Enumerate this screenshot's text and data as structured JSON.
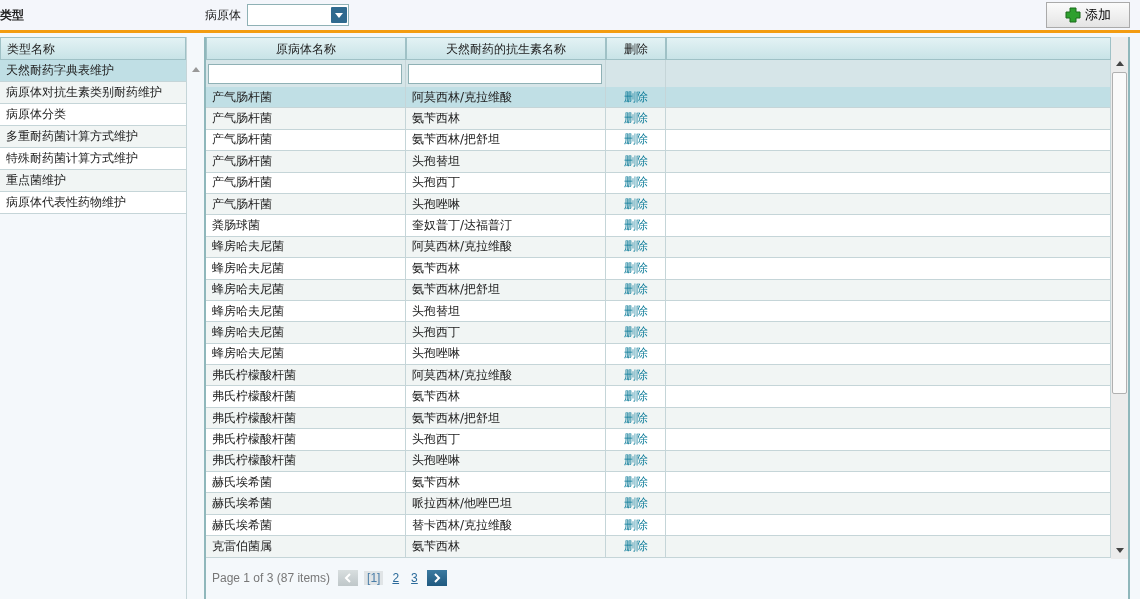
{
  "toolbar": {
    "type_label": "类型",
    "pathogen_label": "病原体",
    "add_button": "添加"
  },
  "sidebar": {
    "header": "类型名称",
    "items": [
      {
        "label": "天然耐药字典表维护",
        "selected": true
      },
      {
        "label": "病原体对抗生素类别耐药维护",
        "selected": false
      },
      {
        "label": "病原体分类",
        "selected": false
      },
      {
        "label": "多重耐药菌计算方式维护",
        "selected": false
      },
      {
        "label": "特殊耐药菌计算方式维护",
        "selected": false
      },
      {
        "label": "重点菌维护",
        "selected": false
      },
      {
        "label": "病原体代表性药物维护",
        "selected": false
      }
    ]
  },
  "table": {
    "columns": [
      "原病体名称",
      "天然耐药的抗生素名称",
      "删除"
    ],
    "rows": [
      {
        "pathogen": "产气肠杆菌",
        "antibiotic": "阿莫西林/克拉维酸",
        "action": "删除",
        "selected": true
      },
      {
        "pathogen": "产气肠杆菌",
        "antibiotic": "氨苄西林",
        "action": "删除",
        "selected": false
      },
      {
        "pathogen": "产气肠杆菌",
        "antibiotic": "氨苄西林/把舒坦",
        "action": "删除",
        "selected": false
      },
      {
        "pathogen": "产气肠杆菌",
        "antibiotic": "头孢替坦",
        "action": "删除",
        "selected": false
      },
      {
        "pathogen": "产气肠杆菌",
        "antibiotic": "头孢西丁",
        "action": "删除",
        "selected": false
      },
      {
        "pathogen": "产气肠杆菌",
        "antibiotic": "头孢唑啉",
        "action": "删除",
        "selected": false
      },
      {
        "pathogen": "粪肠球菌",
        "antibiotic": "奎奴普丁/达福普汀",
        "action": "删除",
        "selected": false
      },
      {
        "pathogen": "蜂房哈夫尼菌",
        "antibiotic": "阿莫西林/克拉维酸",
        "action": "删除",
        "selected": false
      },
      {
        "pathogen": "蜂房哈夫尼菌",
        "antibiotic": "氨苄西林",
        "action": "删除",
        "selected": false
      },
      {
        "pathogen": "蜂房哈夫尼菌",
        "antibiotic": "氨苄西林/把舒坦",
        "action": "删除",
        "selected": false
      },
      {
        "pathogen": "蜂房哈夫尼菌",
        "antibiotic": "头孢替坦",
        "action": "删除",
        "selected": false
      },
      {
        "pathogen": "蜂房哈夫尼菌",
        "antibiotic": "头孢西丁",
        "action": "删除",
        "selected": false
      },
      {
        "pathogen": "蜂房哈夫尼菌",
        "antibiotic": "头孢唑啉",
        "action": "删除",
        "selected": false
      },
      {
        "pathogen": "弗氏柠檬酸杆菌",
        "antibiotic": "阿莫西林/克拉维酸",
        "action": "删除",
        "selected": false
      },
      {
        "pathogen": "弗氏柠檬酸杆菌",
        "antibiotic": "氨苄西林",
        "action": "删除",
        "selected": false
      },
      {
        "pathogen": "弗氏柠檬酸杆菌",
        "antibiotic": "氨苄西林/把舒坦",
        "action": "删除",
        "selected": false
      },
      {
        "pathogen": "弗氏柠檬酸杆菌",
        "antibiotic": "头孢西丁",
        "action": "删除",
        "selected": false
      },
      {
        "pathogen": "弗氏柠檬酸杆菌",
        "antibiotic": "头孢唑啉",
        "action": "删除",
        "selected": false
      },
      {
        "pathogen": "赫氏埃希菌",
        "antibiotic": "氨苄西林",
        "action": "删除",
        "selected": false
      },
      {
        "pathogen": "赫氏埃希菌",
        "antibiotic": "哌拉西林/他唑巴坦",
        "action": "删除",
        "selected": false
      },
      {
        "pathogen": "赫氏埃希菌",
        "antibiotic": "替卡西林/克拉维酸",
        "action": "删除",
        "selected": false
      },
      {
        "pathogen": "克雷伯菌属",
        "antibiotic": "氨苄西林",
        "action": "删除",
        "selected": false
      }
    ]
  },
  "pager": {
    "summary": "Page 1 of 3 (87 items)",
    "prev_disabled": true,
    "pages": [
      {
        "label": "[1]",
        "selected": true
      },
      {
        "label": "2",
        "selected": false
      },
      {
        "label": "3",
        "selected": false
      }
    ]
  }
}
